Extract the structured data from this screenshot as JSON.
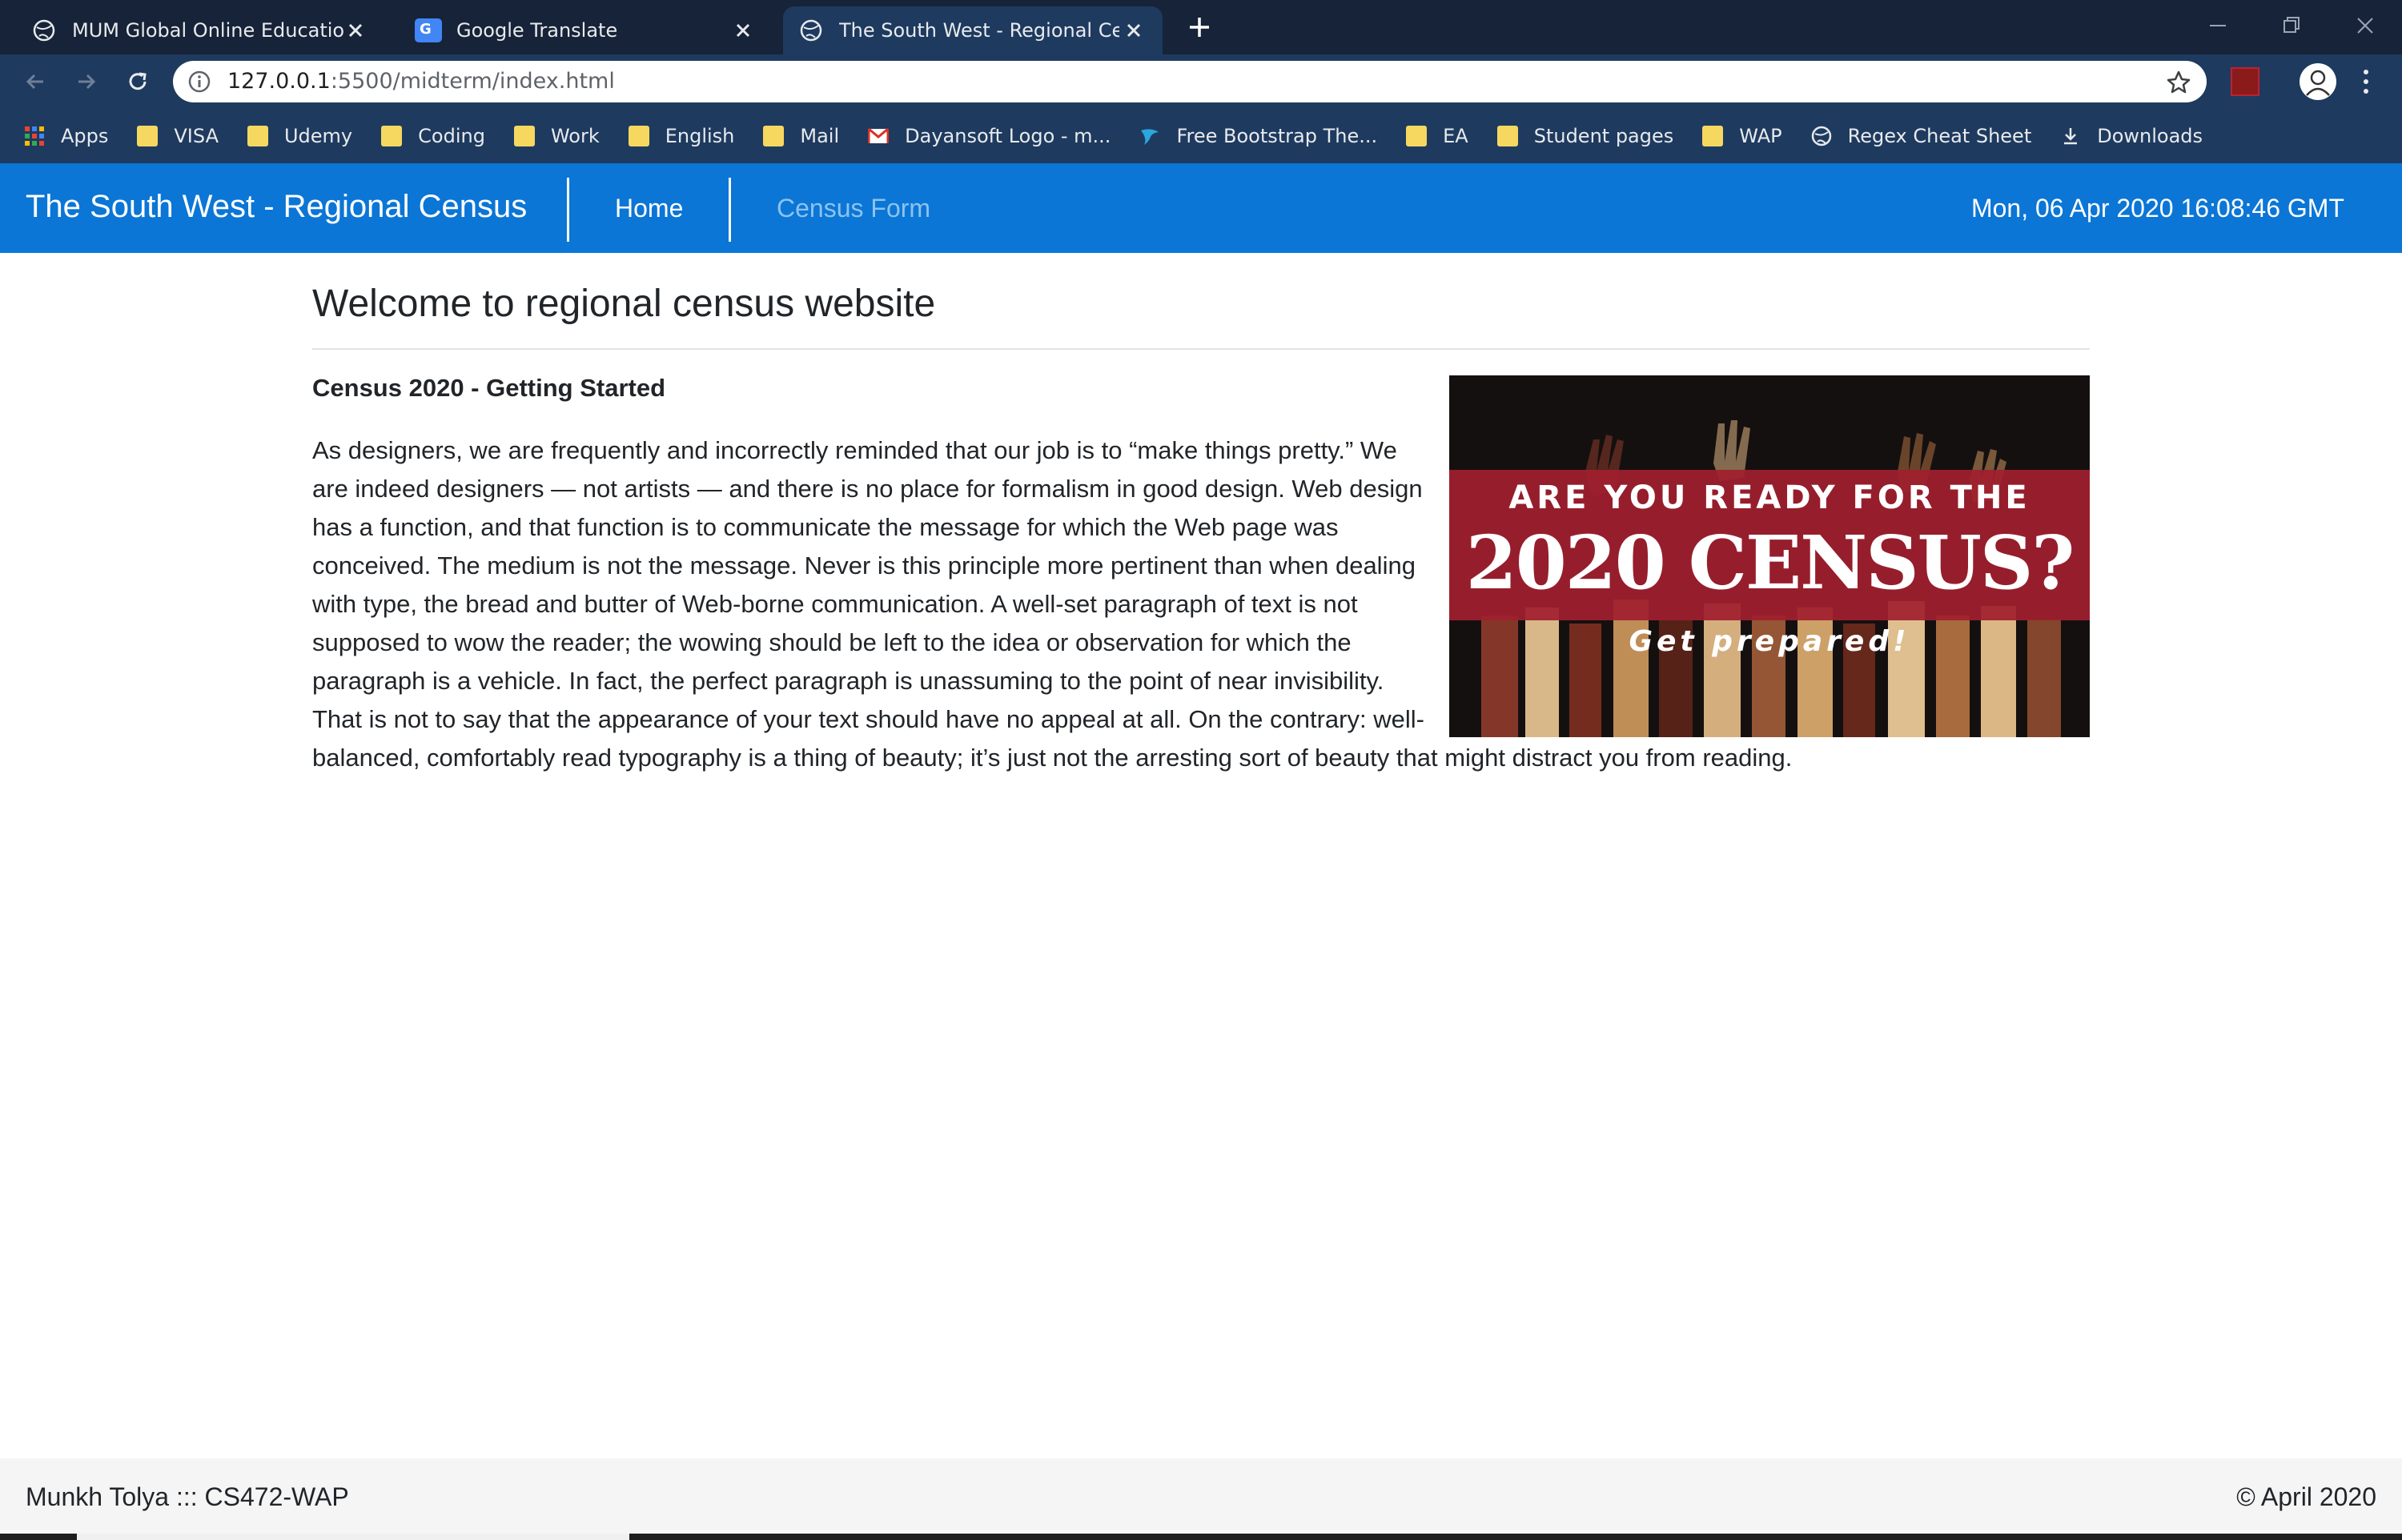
{
  "browser": {
    "tabs": [
      {
        "title": "MUM Global Online Education : C",
        "active": false
      },
      {
        "title": "Google Translate",
        "active": false
      },
      {
        "title": "The South West - Regional Census",
        "active": true
      }
    ],
    "url_host": "127.0.0.1",
    "url_path": ":5500/midterm/index.html",
    "bookmarks": [
      {
        "label": "Apps",
        "icon": "apps-grid-icon"
      },
      {
        "label": "VISA",
        "icon": "folder-icon"
      },
      {
        "label": "Udemy",
        "icon": "folder-icon"
      },
      {
        "label": "Coding",
        "icon": "folder-icon"
      },
      {
        "label": "Work",
        "icon": "folder-icon"
      },
      {
        "label": "English",
        "icon": "folder-icon"
      },
      {
        "label": "Mail",
        "icon": "folder-icon"
      },
      {
        "label": "Dayansoft Logo - m...",
        "icon": "gmail-icon"
      },
      {
        "label": "Free Bootstrap The...",
        "icon": "bootstrap-bird-icon"
      },
      {
        "label": "EA",
        "icon": "folder-icon"
      },
      {
        "label": "Student pages",
        "icon": "folder-icon"
      },
      {
        "label": "WAP",
        "icon": "folder-icon"
      },
      {
        "label": "Regex Cheat Sheet",
        "icon": "globe-icon"
      },
      {
        "label": "Downloads",
        "icon": "download-icon"
      }
    ]
  },
  "navbar": {
    "brand": "The South West - Regional Census",
    "home": "Home",
    "census_form": "Census Form",
    "datetime": "Mon, 06 Apr 2020 16:08:46 GMT"
  },
  "main": {
    "heading": "Welcome to regional census website",
    "subheading": "Census 2020 - Getting Started",
    "paragraph": "As designers, we are frequently and incorrectly reminded that our job is to “make things pretty.” We are indeed designers — not artists — and there is no place for formalism in good design. Web design has a function, and that function is to communicate the message for which the Web page was conceived. The medium is not the message. Never is this principle more pertinent than when dealing with type, the bread and butter of Web-borne communication. A well-set paragraph of text is not supposed to wow the reader; the wowing should be left to the idea or observation for which the paragraph is a vehicle. In fact, the perfect paragraph is unassuming to the point of near invisibility. That is not to say that the appearance of your text should have no appeal at all. On the contrary: well-balanced, comfortably read typography is a thing of beauty; it’s just not the arresting sort of beauty that might distract you from reading.",
    "image": {
      "line1": "ARE YOU READY FOR THE",
      "line2": "2020 CENSUS?",
      "line3": "Get prepared!"
    }
  },
  "footer": {
    "left": "Munkh Tolya ::: CS472-WAP",
    "right": "© April 2020"
  },
  "colors": {
    "navbar": "#0b76d6",
    "chrome_dark": "#162338",
    "chrome_toolbar": "#1e3a5f",
    "census_red": "#a01f2e"
  }
}
